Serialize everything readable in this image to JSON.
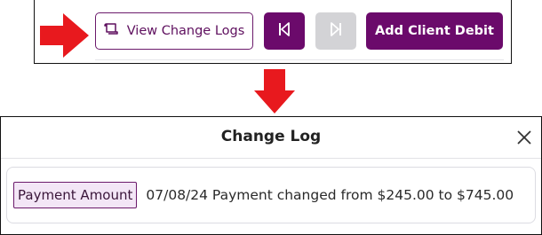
{
  "toolbar": {
    "view_change_logs_label": "View Change Logs",
    "add_client_debit_label": "Add Client Debit"
  },
  "change_log": {
    "title": "Change Log",
    "entries": [
      {
        "field": "Payment Amount",
        "text": "07/08/24 Payment changed from $245.00 to $745.00"
      }
    ]
  },
  "colors": {
    "primary": "#6b0a6b",
    "disabled": "#d3d3d6",
    "arrow_red": "#e8191e",
    "badge_bg": "#f3e6f6"
  },
  "icons": {
    "logs": "scroll-icon",
    "first": "skip-back-icon",
    "next": "skip-forward-icon",
    "close": "close-icon"
  }
}
